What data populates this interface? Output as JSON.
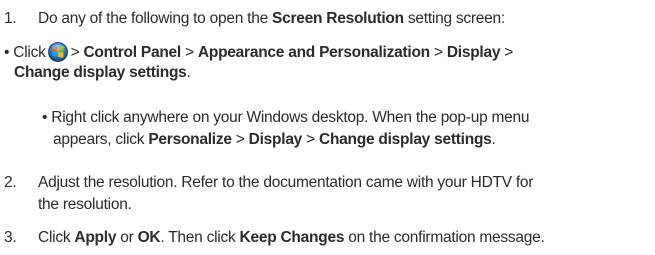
{
  "steps": [
    {
      "number": "1.",
      "text_a": "Do any of the following to open the ",
      "bold_a": "Screen Resolution",
      "text_b": " setting screen:"
    },
    {
      "number": "2.",
      "line1": "Adjust the resolution. Refer to the documentation came with your HDTV for",
      "line2": "the resolution."
    },
    {
      "number": "3.",
      "text_a": "Click ",
      "bold_a": "Apply",
      "text_b": " or ",
      "bold_b": "OK",
      "text_c": ". Then click ",
      "bold_c": "Keep Changes",
      "text_d": " on the confirmation message."
    }
  ],
  "bullet1": {
    "bullet": "•",
    "click": "Click",
    "icon": "windows-start-orb-icon",
    "sep": ">",
    "control_panel": "Control Panel",
    "appearance": "Appearance and Personalization",
    "display": "Display",
    "change_display": "Change display settings",
    "period": "."
  },
  "bullet2": {
    "bullet": "•",
    "line1": "Right click anywhere on your Windows desktop. When the pop-up menu",
    "appears": "appears, click ",
    "personalize": "Personalize",
    "sep": ">",
    "display": "Display",
    "change_display": "Change display settings",
    "period": "."
  },
  "colors": {
    "text": "#2b2b2b",
    "background": "#ffffff"
  }
}
